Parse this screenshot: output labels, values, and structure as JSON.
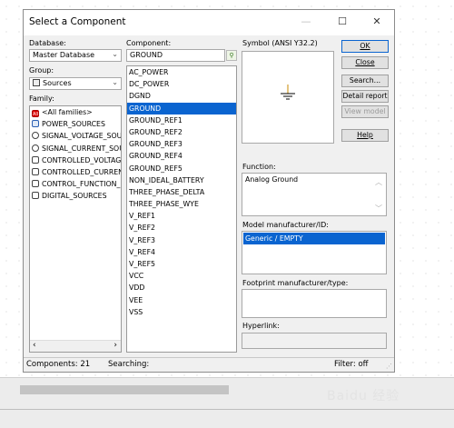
{
  "dialog": {
    "title": "Select a Component",
    "minimize_glyph": "—",
    "maximize_glyph": "☐",
    "close_glyph": "✕"
  },
  "database": {
    "label": "Database:",
    "value": "Master Database"
  },
  "group": {
    "label": "Group:",
    "value": "Sources",
    "icon": "sources-icon"
  },
  "family": {
    "label": "Family:",
    "items": [
      {
        "label": "<All families>",
        "icon": "all-families-icon",
        "icon_text": "All"
      },
      {
        "label": "POWER_SOURCES",
        "icon": "power-sources-icon",
        "icon_text": ""
      },
      {
        "label": "SIGNAL_VOLTAGE_SOU",
        "icon": "signal-voltage-icon",
        "icon_text": ""
      },
      {
        "label": "SIGNAL_CURRENT_SOU",
        "icon": "signal-current-icon",
        "icon_text": ""
      },
      {
        "label": "CONTROLLED_VOLTAGE",
        "icon": "controlled-voltage-icon",
        "icon_text": ""
      },
      {
        "label": "CONTROLLED_CURRENT",
        "icon": "controlled-current-icon",
        "icon_text": ""
      },
      {
        "label": "CONTROL_FUNCTION_B",
        "icon": "control-function-icon",
        "icon_text": ""
      },
      {
        "label": "DIGITAL_SOURCES",
        "icon": "digital-sources-icon",
        "icon_text": ""
      }
    ]
  },
  "component": {
    "label": "Component:",
    "search_value": "GROUND",
    "selected_index": 3,
    "items": [
      "AC_POWER",
      "DC_POWER",
      "DGND",
      "GROUND",
      "GROUND_REF1",
      "GROUND_REF2",
      "GROUND_REF3",
      "GROUND_REF4",
      "GROUND_REF5",
      "NON_IDEAL_BATTERY",
      "THREE_PHASE_DELTA",
      "THREE_PHASE_WYE",
      "V_REF1",
      "V_REF2",
      "V_REF3",
      "V_REF4",
      "V_REF5",
      "VCC",
      "VDD",
      "VEE",
      "VSS"
    ]
  },
  "symbol": {
    "label": "Symbol (ANSI Y32.2)"
  },
  "function": {
    "label": "Function:",
    "value": "Analog Ground"
  },
  "model": {
    "label": "Model manufacturer/ID:",
    "items": [
      "Generic / EMPTY"
    ]
  },
  "footprint": {
    "label": "Footprint manufacturer/type:"
  },
  "hyperlink": {
    "label": "Hyperlink:"
  },
  "buttons": {
    "ok": "OK",
    "close": "Close",
    "search": "Search...",
    "detail_report": "Detail report",
    "view_model": "View model",
    "help": "Help"
  },
  "status": {
    "components": "Components: 21",
    "searching": "Searching:",
    "filter": "Filter: off"
  },
  "watermark": "Baidu 经验",
  "colors": {
    "selection": "#0a64d0",
    "dialog_bg": "#f0f0f0"
  }
}
